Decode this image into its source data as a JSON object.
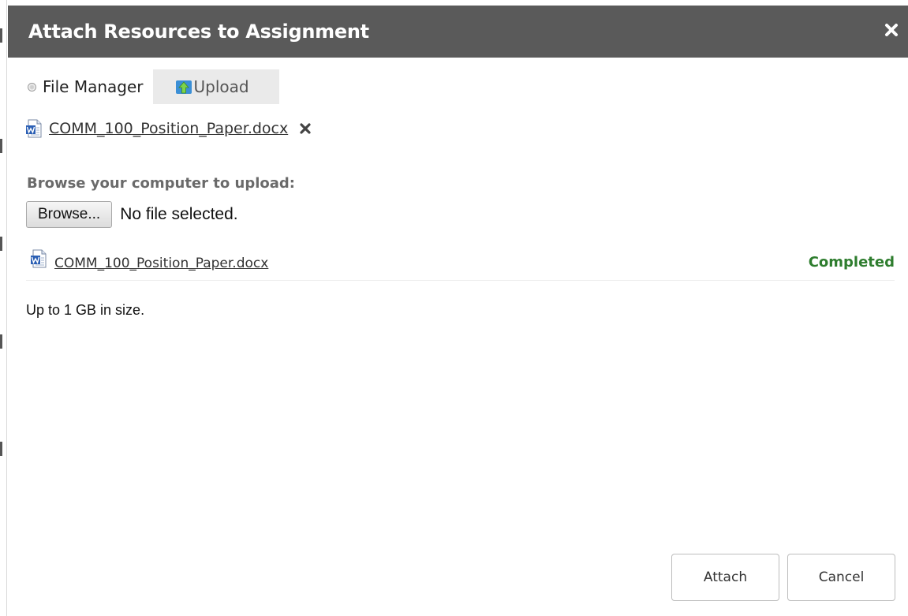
{
  "dialog": {
    "title": "Attach Resources to Assignment",
    "close_icon": "close-x-icon"
  },
  "source": {
    "file_manager_label": "File Manager",
    "upload_tab_label": "Upload",
    "upload_icon": "upload-arrow-icon"
  },
  "attached_file": {
    "name": "COMM_100_Position_Paper.docx",
    "icon": "word-document-icon",
    "remove_icon": "remove-x-icon"
  },
  "browse": {
    "label": "Browse your computer to upload:",
    "button_label": "Browse...",
    "status_text": "No file selected."
  },
  "upload_queue": [
    {
      "name": "COMM_100_Position_Paper.docx",
      "icon": "word-document-icon",
      "status": "Completed"
    }
  ],
  "size_note": "Up to 1 GB in size.",
  "footer": {
    "attach_label": "Attach",
    "cancel_label": "Cancel"
  },
  "colors": {
    "titlebar_bg": "#5a5a5a",
    "status_completed": "#2e7d2e"
  }
}
